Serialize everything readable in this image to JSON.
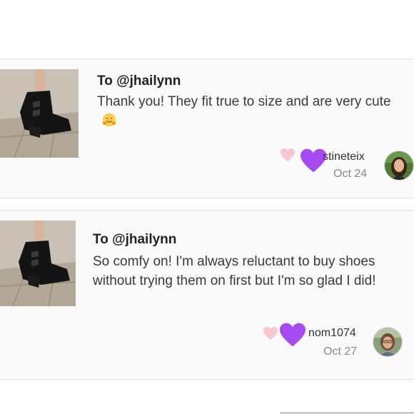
{
  "reviews": [
    {
      "recipient": "To @jhailynn",
      "message": "Thank you! They fit true to size and are very cute",
      "username": "stineteix",
      "date": "Oct 24",
      "icons": [
        "pink-heart-icon",
        "purple-heart-icon",
        "hugging-face-emoji"
      ]
    },
    {
      "recipient": "To @jhailynn",
      "message": "So comfy on! I'm always reluctant to buy shoes without trying them on first but I'm so glad I did!",
      "username": "nom1074",
      "date": "Oct 27",
      "icons": [
        "pink-heart-icon",
        "purple-heart-icon"
      ]
    }
  ],
  "colors": {
    "card_background": "#fafafa",
    "pink_heart": "#f7c6cf",
    "purple_heart": "#a64bf0",
    "date_text": "#8a8a8a"
  }
}
